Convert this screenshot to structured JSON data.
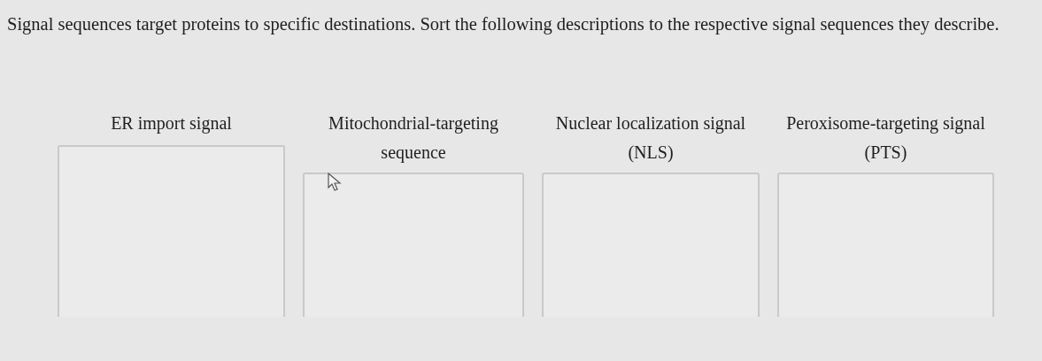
{
  "prompt": "Signal sequences target proteins to specific destinations. Sort the following descriptions to the respective signal sequences they describe.",
  "categories": [
    {
      "label": "ER import signal"
    },
    {
      "label": "Mitochondrial-targeting sequence"
    },
    {
      "label": "Nuclear localization signal (NLS)"
    },
    {
      "label": "Peroxisome-targeting signal (PTS)"
    }
  ]
}
